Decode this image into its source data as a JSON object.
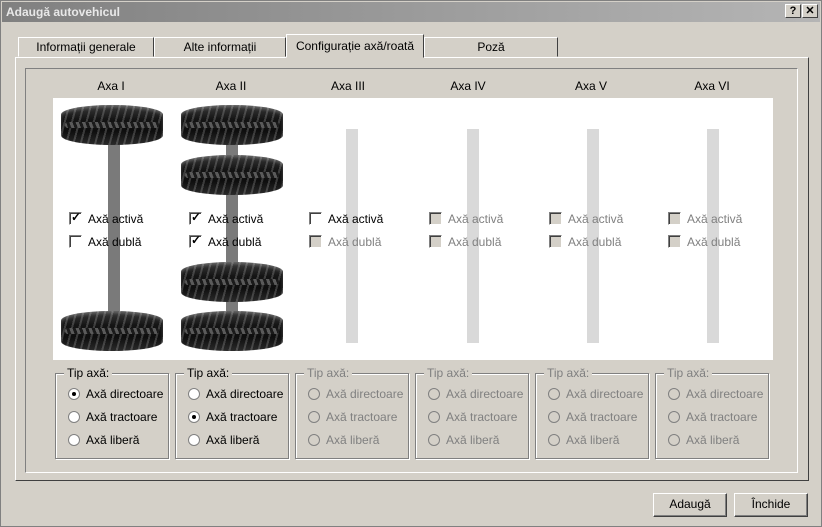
{
  "window": {
    "title": "Adaugă autovehicul",
    "help_label": "?",
    "close_label": "✕"
  },
  "tabs": [
    {
      "label": "Informații generale",
      "active": false
    },
    {
      "label": "Alte informații",
      "active": false
    },
    {
      "label": "Configurație axă/roată",
      "active": true
    },
    {
      "label": "Poză",
      "active": false
    }
  ],
  "axles": [
    {
      "label": "Axa I",
      "active_label": "Axă activă",
      "double_label": "Axă dublă",
      "active": true,
      "double": false,
      "enabled": true,
      "type_legend": "Tip axă:",
      "types": [
        "Axă directoare",
        "Axă tractoare",
        "Axă liberă"
      ],
      "selected_type": 0
    },
    {
      "label": "Axa II",
      "active_label": "Axă activă",
      "double_label": "Axă dublă",
      "active": true,
      "double": true,
      "enabled": true,
      "type_legend": "Tip axă:",
      "types": [
        "Axă directoare",
        "Axă tractoare",
        "Axă liberă"
      ],
      "selected_type": 1
    },
    {
      "label": "Axa III",
      "active_label": "Axă activă",
      "double_label": "Axă dublă",
      "active": false,
      "double": false,
      "enabled": "partial",
      "type_legend": "Tip axă:",
      "types": [
        "Axă directoare",
        "Axă tractoare",
        "Axă liberă"
      ],
      "selected_type": -1
    },
    {
      "label": "Axa IV",
      "active_label": "Axă activă",
      "double_label": "Axă dublă",
      "active": false,
      "double": false,
      "enabled": false,
      "type_legend": "Tip axă:",
      "types": [
        "Axă directoare",
        "Axă tractoare",
        "Axă liberă"
      ],
      "selected_type": -1
    },
    {
      "label": "Axa V",
      "active_label": "Axă activă",
      "double_label": "Axă dublă",
      "active": false,
      "double": false,
      "enabled": false,
      "type_legend": "Tip axă:",
      "types": [
        "Axă directoare",
        "Axă tractoare",
        "Axă liberă"
      ],
      "selected_type": -1
    },
    {
      "label": "Axa VI",
      "active_label": "Axă activă",
      "double_label": "Axă dublă",
      "active": false,
      "double": false,
      "enabled": false,
      "type_legend": "Tip axă:",
      "types": [
        "Axă directoare",
        "Axă tractoare",
        "Axă liberă"
      ],
      "selected_type": -1
    }
  ],
  "buttons": {
    "add_label": "Adaugă",
    "close_label": "Închide"
  }
}
